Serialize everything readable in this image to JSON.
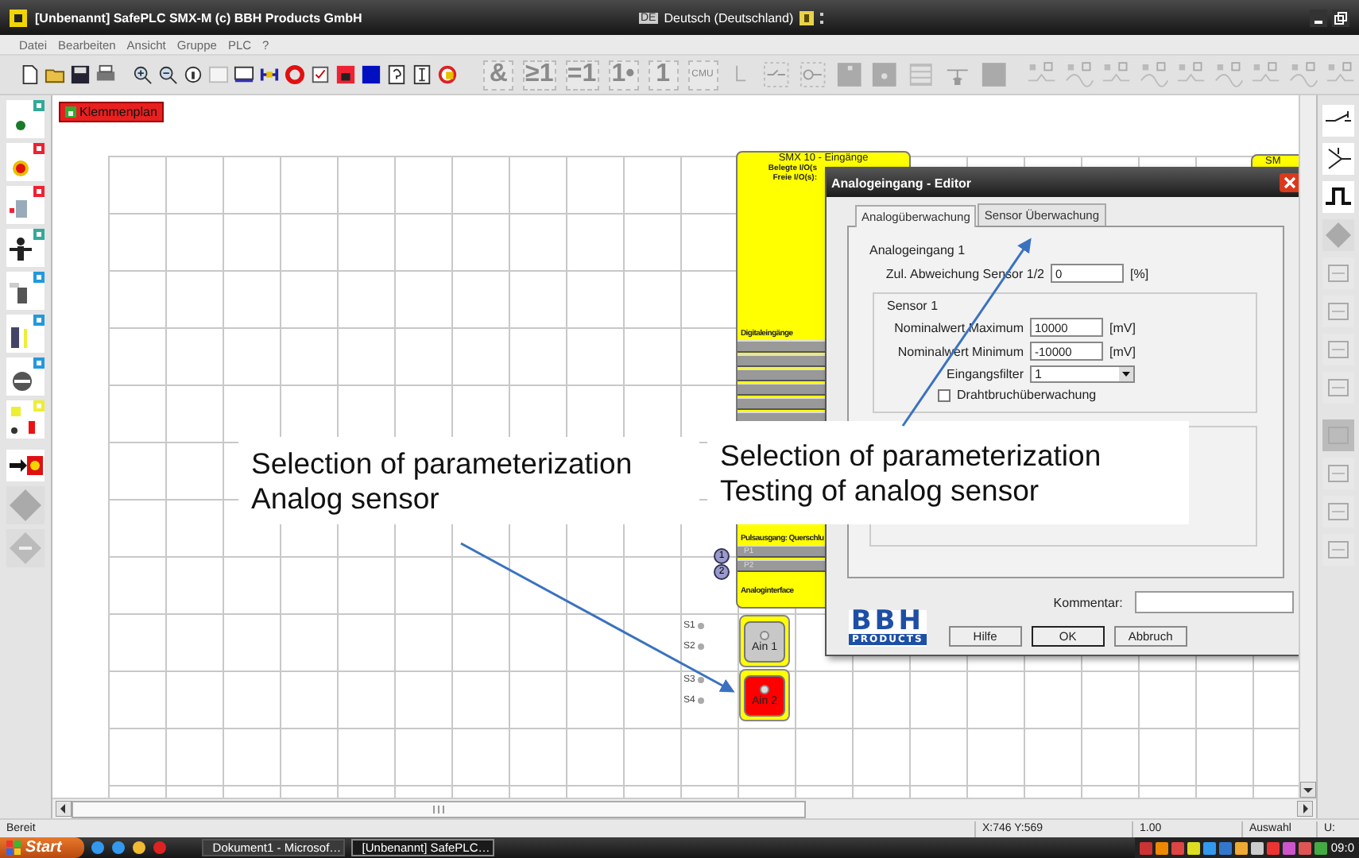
{
  "window": {
    "title": "[Unbenannt] SafePLC SMX-M (c) BBH Products GmbH"
  },
  "language_bar": {
    "code": "DE",
    "label": "Deutsch (Deutschland)"
  },
  "menu": [
    "Datei",
    "Bearbeiten",
    "Ansicht",
    "Gruppe",
    "PLC",
    "?"
  ],
  "logic_buttons": [
    "&",
    "≥1",
    "=1",
    "1•",
    "1",
    "CMU"
  ],
  "canvas": {
    "tab": "Klemmenplan",
    "input_block": {
      "title": "SMX 10 - Eingänge",
      "info": [
        "Belegte I/O(s",
        "Freie I/O(s):"
      ],
      "digital_section": "Digitaleingänge",
      "pulse_section": "Pulsausgang: Querschlu",
      "pulse_outputs": [
        {
          "number": "1",
          "label": "P1"
        },
        {
          "number": "2",
          "label": "P2"
        }
      ],
      "analog_section": "Analoginterface"
    },
    "second_block": {
      "title": "SM"
    },
    "analog_inputs": [
      {
        "label": "Ain 1",
        "active": false,
        "pins": [
          "S1",
          "S2"
        ]
      },
      {
        "label": "Ain 2",
        "active": true,
        "pins": [
          "S3",
          "S4"
        ]
      }
    ]
  },
  "dialog": {
    "title": "Analogeingang - Editor",
    "tabs": [
      {
        "label": "Analogüberwachung",
        "selected": true
      },
      {
        "label": "Sensor Überwachung",
        "selected": false
      }
    ],
    "heading": "Analogeingang 1",
    "deviation": {
      "label": "Zul. Abweichung Sensor 1/2",
      "value": "0",
      "unit": "[%]"
    },
    "group": {
      "title": "Sensor 1",
      "fields": [
        {
          "kind": "input",
          "label": "Nominalwert Maximum",
          "value": "10000",
          "unit": "[mV]"
        },
        {
          "kind": "input",
          "label": "Nominalwert Minimum",
          "value": "-10000",
          "unit": "[mV]"
        },
        {
          "kind": "select",
          "label": "Eingangsfilter",
          "value": "1"
        }
      ],
      "wire_break": {
        "label": "Drahtbruchüberwachung",
        "checked": false
      }
    },
    "comment": {
      "label": "Kommentar:"
    },
    "logo": {
      "top": "BBH",
      "bottom": "PRODUCTS"
    },
    "buttons": [
      "Hilfe",
      "OK",
      "Abbruch"
    ]
  },
  "annotations": [
    {
      "lines": [
        "Selection of parameterization",
        "Analog sensor"
      ]
    },
    {
      "lines": [
        "Selection of parameterization",
        "Testing of analog sensor"
      ]
    }
  ],
  "status_bar": [
    "Bereit",
    "X:746 Y:569",
    "1.00",
    "Auswahl",
    "U:"
  ],
  "taskbar": {
    "start": "Start",
    "tasks": [
      {
        "label": "Dokument1 - Microsof…",
        "selected": false
      },
      {
        "label": "[Unbenannt] SafePLC…",
        "selected": true
      }
    ],
    "clock": "09:0"
  }
}
